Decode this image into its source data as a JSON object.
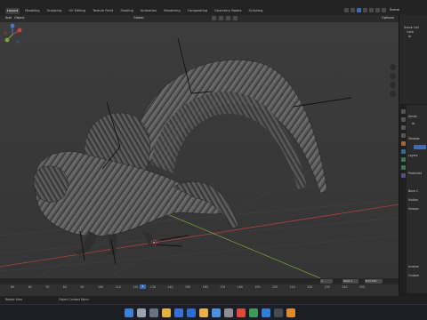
{
  "app": {
    "workspace_tabs": [
      "Layout",
      "Modeling",
      "Sculpting",
      "UV Editing",
      "Texture Paint",
      "Shading",
      "Animation",
      "Rendering",
      "Compositing",
      "Geometry Nodes",
      "Scripting"
    ],
    "active_tab": "Layout",
    "scene_label": "Scene"
  },
  "viewport_header": {
    "mode": "Add",
    "menu_object": "Object",
    "orientation": "Global",
    "options_label": "Options"
  },
  "outliner": {
    "rows": [
      "Scene Coll",
      "Colle",
      "Ar"
    ]
  },
  "properties": {
    "rows": [
      "Armat",
      "Ar",
      "Viewpor",
      "Layers",
      "Protected",
      "Bone C",
      "Motion",
      "Viewpo",
      "Inverse",
      "Custom"
    ]
  },
  "timeline": {
    "frame_ticks": [
      "80",
      "60",
      "70",
      "80",
      "90",
      "100",
      "110",
      "120",
      "130",
      "140",
      "150",
      "160",
      "170",
      "180",
      "190",
      "200",
      "210",
      "220",
      "230",
      "240",
      "250"
    ],
    "current_frame": "1",
    "start_label": "Start",
    "start_value": "1",
    "end_label": "End",
    "end_value": "250",
    "frame_field": "1"
  },
  "status": {
    "left": "Rotate View",
    "middle": "Object Context Menu"
  },
  "colors": {
    "accent_blue": "#3d6eb5",
    "viewport_bg": "#393939",
    "x_axis": "#b0413e",
    "y_axis": "#7fa33a"
  },
  "taskbar": {
    "icons": [
      "windows-start-icon",
      "search-icon",
      "task-view-icon",
      "file-explorer-icon",
      "store-icon",
      "mail-icon",
      "folder-icon",
      "photos-icon",
      "settings-icon",
      "chrome-icon",
      "app-icon",
      "vscode-icon",
      "terminal-icon",
      "blender-icon"
    ]
  }
}
